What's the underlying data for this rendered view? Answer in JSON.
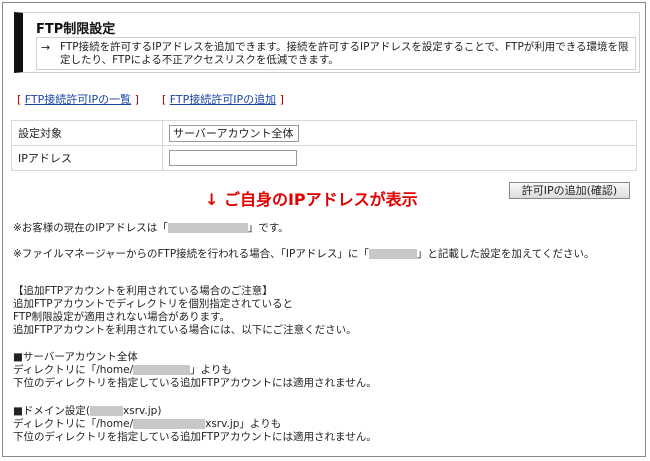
{
  "header": {
    "title": "FTP制限設定",
    "arrow": "→",
    "description": "FTP接続を許可するIPアドレスを追加できます。接続を許可するIPアドレスを設定することで、FTPが利用できる環境を限定したり、FTPによる不正アクセスリスクを低減できます。"
  },
  "links": {
    "open_bracket": "[",
    "close_bracket": "]",
    "list_label": "FTP接続許可IPの一覧",
    "add_label": "FTP接続許可IPの追加"
  },
  "form": {
    "target_label": "設定対象",
    "target_value": "サーバーアカウント全体",
    "ip_label": "IPアドレス",
    "ip_value": "",
    "confirm_button": "許可IPの追加(確認)"
  },
  "annotation": "↓ ご自身のIPアドレスが表示",
  "notes": {
    "current_ip_pre": "※お客様の現在のIPアドレスは「",
    "current_ip_post": "」です。",
    "file_manager_pre": "※ファイルマネージャーからのFTP接続を行われる場合、「IPアドレス」に「",
    "file_manager_post": "」と記載した設定を加えてください。",
    "additional_heading": "【追加FTPアカウントを利用されている場合のご注意】",
    "additional_line1": "追加FTPアカウントでディレクトリを個別指定されていると",
    "additional_line2": "FTP制限設定が適用されない場合があります。",
    "additional_line3": "追加FTPアカウントを利用されている場合には、以下にご注意ください。",
    "server_heading": "■サーバーアカウント全体",
    "server_dir_pre": "ディレクトリに「/home/",
    "server_dir_post": "」よりも",
    "server_line2": "下位のディレクトリを指定している追加FTPアカウントには適用されません。",
    "domain_heading_pre": "■ドメイン設定(",
    "domain_heading_post": "xsrv.jp)",
    "domain_dir_pre": "ディレクトリに「/home/",
    "domain_dir_post": "xsrv.jp」よりも",
    "domain_line2": "下位のディレクトリを指定している追加FTPアカウントには適用されません。"
  }
}
